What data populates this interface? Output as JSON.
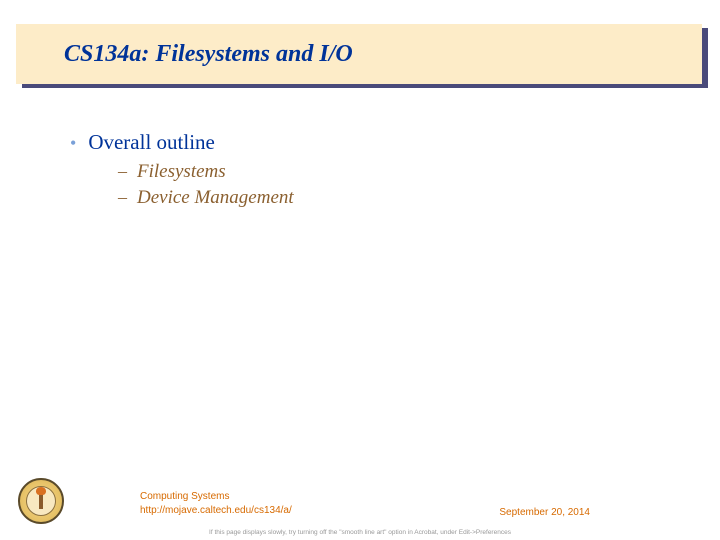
{
  "title": "CS134a: Filesystems and  I/O",
  "bullets": {
    "main": "Overall outline",
    "sub1": "Filesystems",
    "sub2": "Device Management"
  },
  "footer": {
    "line1": "Computing Systems",
    "line2": "http://mojave.caltech.edu/cs134/a/",
    "date": "September 20, 2014"
  },
  "note": "If this page displays slowly, try turning off the \"smooth line art\" option in Acrobat, under Edit->Preferences"
}
